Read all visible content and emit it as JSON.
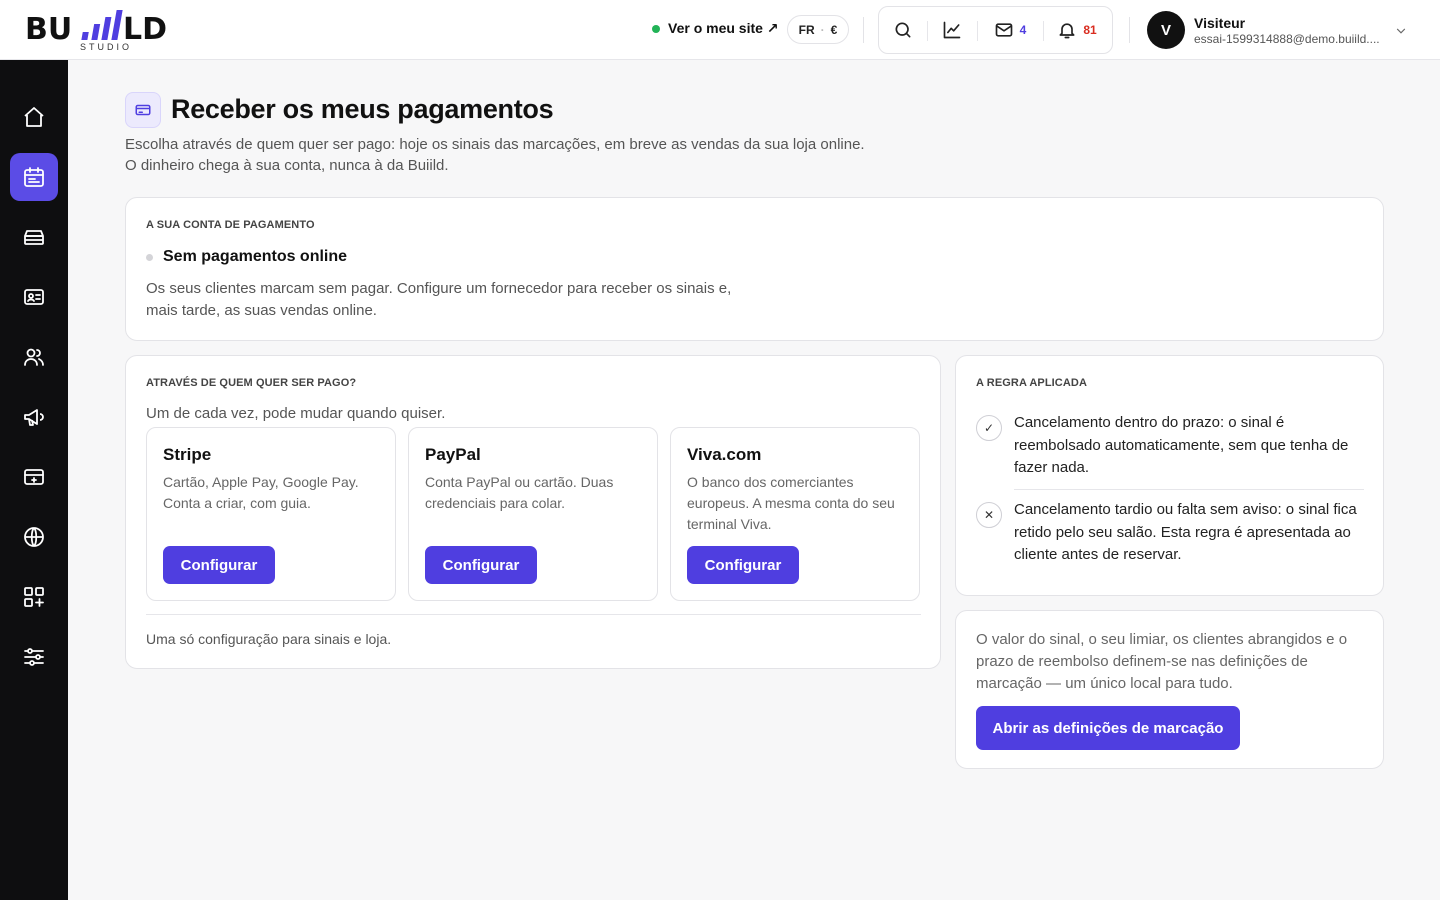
{
  "brand": {
    "logo_text": "BUIILD",
    "logo_sub": "STUDIO"
  },
  "header": {
    "site_link": "Ver o meu site ↗",
    "lang": "FR",
    "currency": "€",
    "mail_count": "4",
    "notif_count": "81",
    "user_initial": "V",
    "user_name": "Visiteur",
    "user_email": "essai-1599314888@demo.buiild...."
  },
  "sidebar": {
    "items": [
      {
        "name": "home-icon"
      },
      {
        "name": "calendar-icon",
        "active": true
      },
      {
        "name": "inventory-icon"
      },
      {
        "name": "contact-card-icon"
      },
      {
        "name": "users-icon"
      },
      {
        "name": "megaphone-icon"
      },
      {
        "name": "payment-terminal-icon"
      },
      {
        "name": "globe-icon"
      },
      {
        "name": "apps-icon"
      },
      {
        "name": "sliders-icon"
      }
    ]
  },
  "page": {
    "title": "Receber os meus pagamentos",
    "description": "Escolha através de quem quer ser pago: hoje os sinais das marcações, em breve as vendas da sua loja online. O dinheiro chega à sua conta, nunca à da Buiild."
  },
  "account": {
    "eyebrow": "A SUA CONTA DE PAGAMENTO",
    "status": "Sem pagamentos online",
    "description": "Os seus clientes marcam sem pagar. Configure um fornecedor para receber os sinais e, mais tarde, as suas vendas online."
  },
  "providers": {
    "eyebrow": "ATRAVÉS DE QUEM QUER SER PAGO?",
    "subtitle": "Um de cada vez, pode mudar quando quiser.",
    "items": [
      {
        "name": "Stripe",
        "desc": "Cartão, Apple Pay, Google Pay. Conta a criar, com guia.",
        "button": "Configurar"
      },
      {
        "name": "PayPal",
        "desc": "Conta PayPal ou cartão. Duas credenciais para colar.",
        "button": "Configurar"
      },
      {
        "name": "Viva.com",
        "desc": "O banco dos comerciantes europeus. A mesma conta do seu terminal Viva.",
        "button": "Configurar"
      }
    ],
    "note": "Uma só configuração para sinais e loja."
  },
  "rule": {
    "eyebrow": "A REGRA APLICADA",
    "items": [
      {
        "symbol": "✓",
        "text": "Cancelamento dentro do prazo: o sinal é reembolsado automaticamente, sem que tenha de fazer nada."
      },
      {
        "symbol": "✕",
        "text": "Cancelamento tardio ou falta sem aviso: o sinal fica retido pelo seu salão. Esta regra é apresentada ao cliente antes de reservar."
      }
    ]
  },
  "settings": {
    "text": "O valor do sinal, o seu limiar, os clientes abrangidos e o prazo de reembolso definem-se nas definições de marcação — um único local para tudo.",
    "button": "Abrir as definições de marcação"
  },
  "colors": {
    "accent": "#4f3ee0",
    "sidebar": "#0e0e10",
    "online": "#22b357",
    "mail": "#4f3ee0",
    "notif": "#d92d20"
  }
}
